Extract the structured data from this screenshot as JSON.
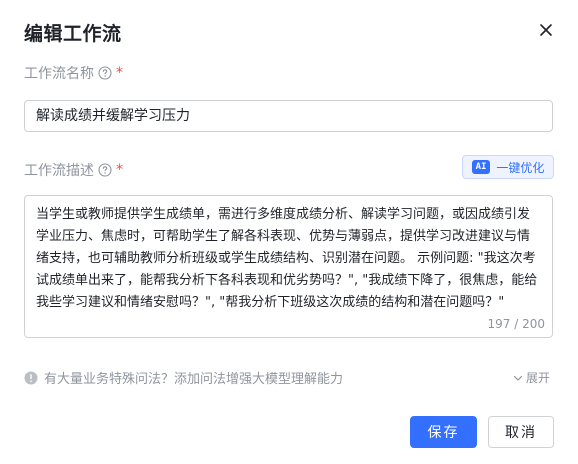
{
  "dialog": {
    "title": "编辑工作流",
    "close_icon": "close-icon"
  },
  "name_field": {
    "label": "工作流名称",
    "required_mark": "*",
    "help_icon": "question-circle-icon",
    "value": "解读成绩并缓解学习压力"
  },
  "description_field": {
    "label": "工作流描述",
    "required_mark": "*",
    "help_icon": "question-circle-icon",
    "value": "当学生或教师提供学生成绩单，需进行多维度成绩分析、解读学习问题，或因成绩引发学业压力、焦虑时，可帮助学生了解各科表现、优势与薄弱点，提供学习改进建议与情绪支持，也可辅助教师分析班级或学生成绩结构、识别潜在问题。 示例问题: \"我这次考试成绩单出来了，能帮我分析下各科表现和优劣势吗？\", \"我成绩下降了，很焦虑，能给我些学习建议和情绪安慰吗？\", \"帮我分析下班级这次成绩的结构和潜在问题吗？\"",
    "counter": "197 / 200",
    "optimize_button": {
      "badge": "AI",
      "label": "一键优化"
    }
  },
  "tip": {
    "icon": "info-circle-icon",
    "text": "有大量业务特殊问法？添加问法增强大模型理解能力",
    "expand_label": "展开",
    "expand_icon": "chevron-down-icon"
  },
  "footer": {
    "save_label": "保存",
    "cancel_label": "取消"
  },
  "colors": {
    "primary": "#3370ff",
    "required": "#f54a45",
    "muted": "#8f959e"
  }
}
